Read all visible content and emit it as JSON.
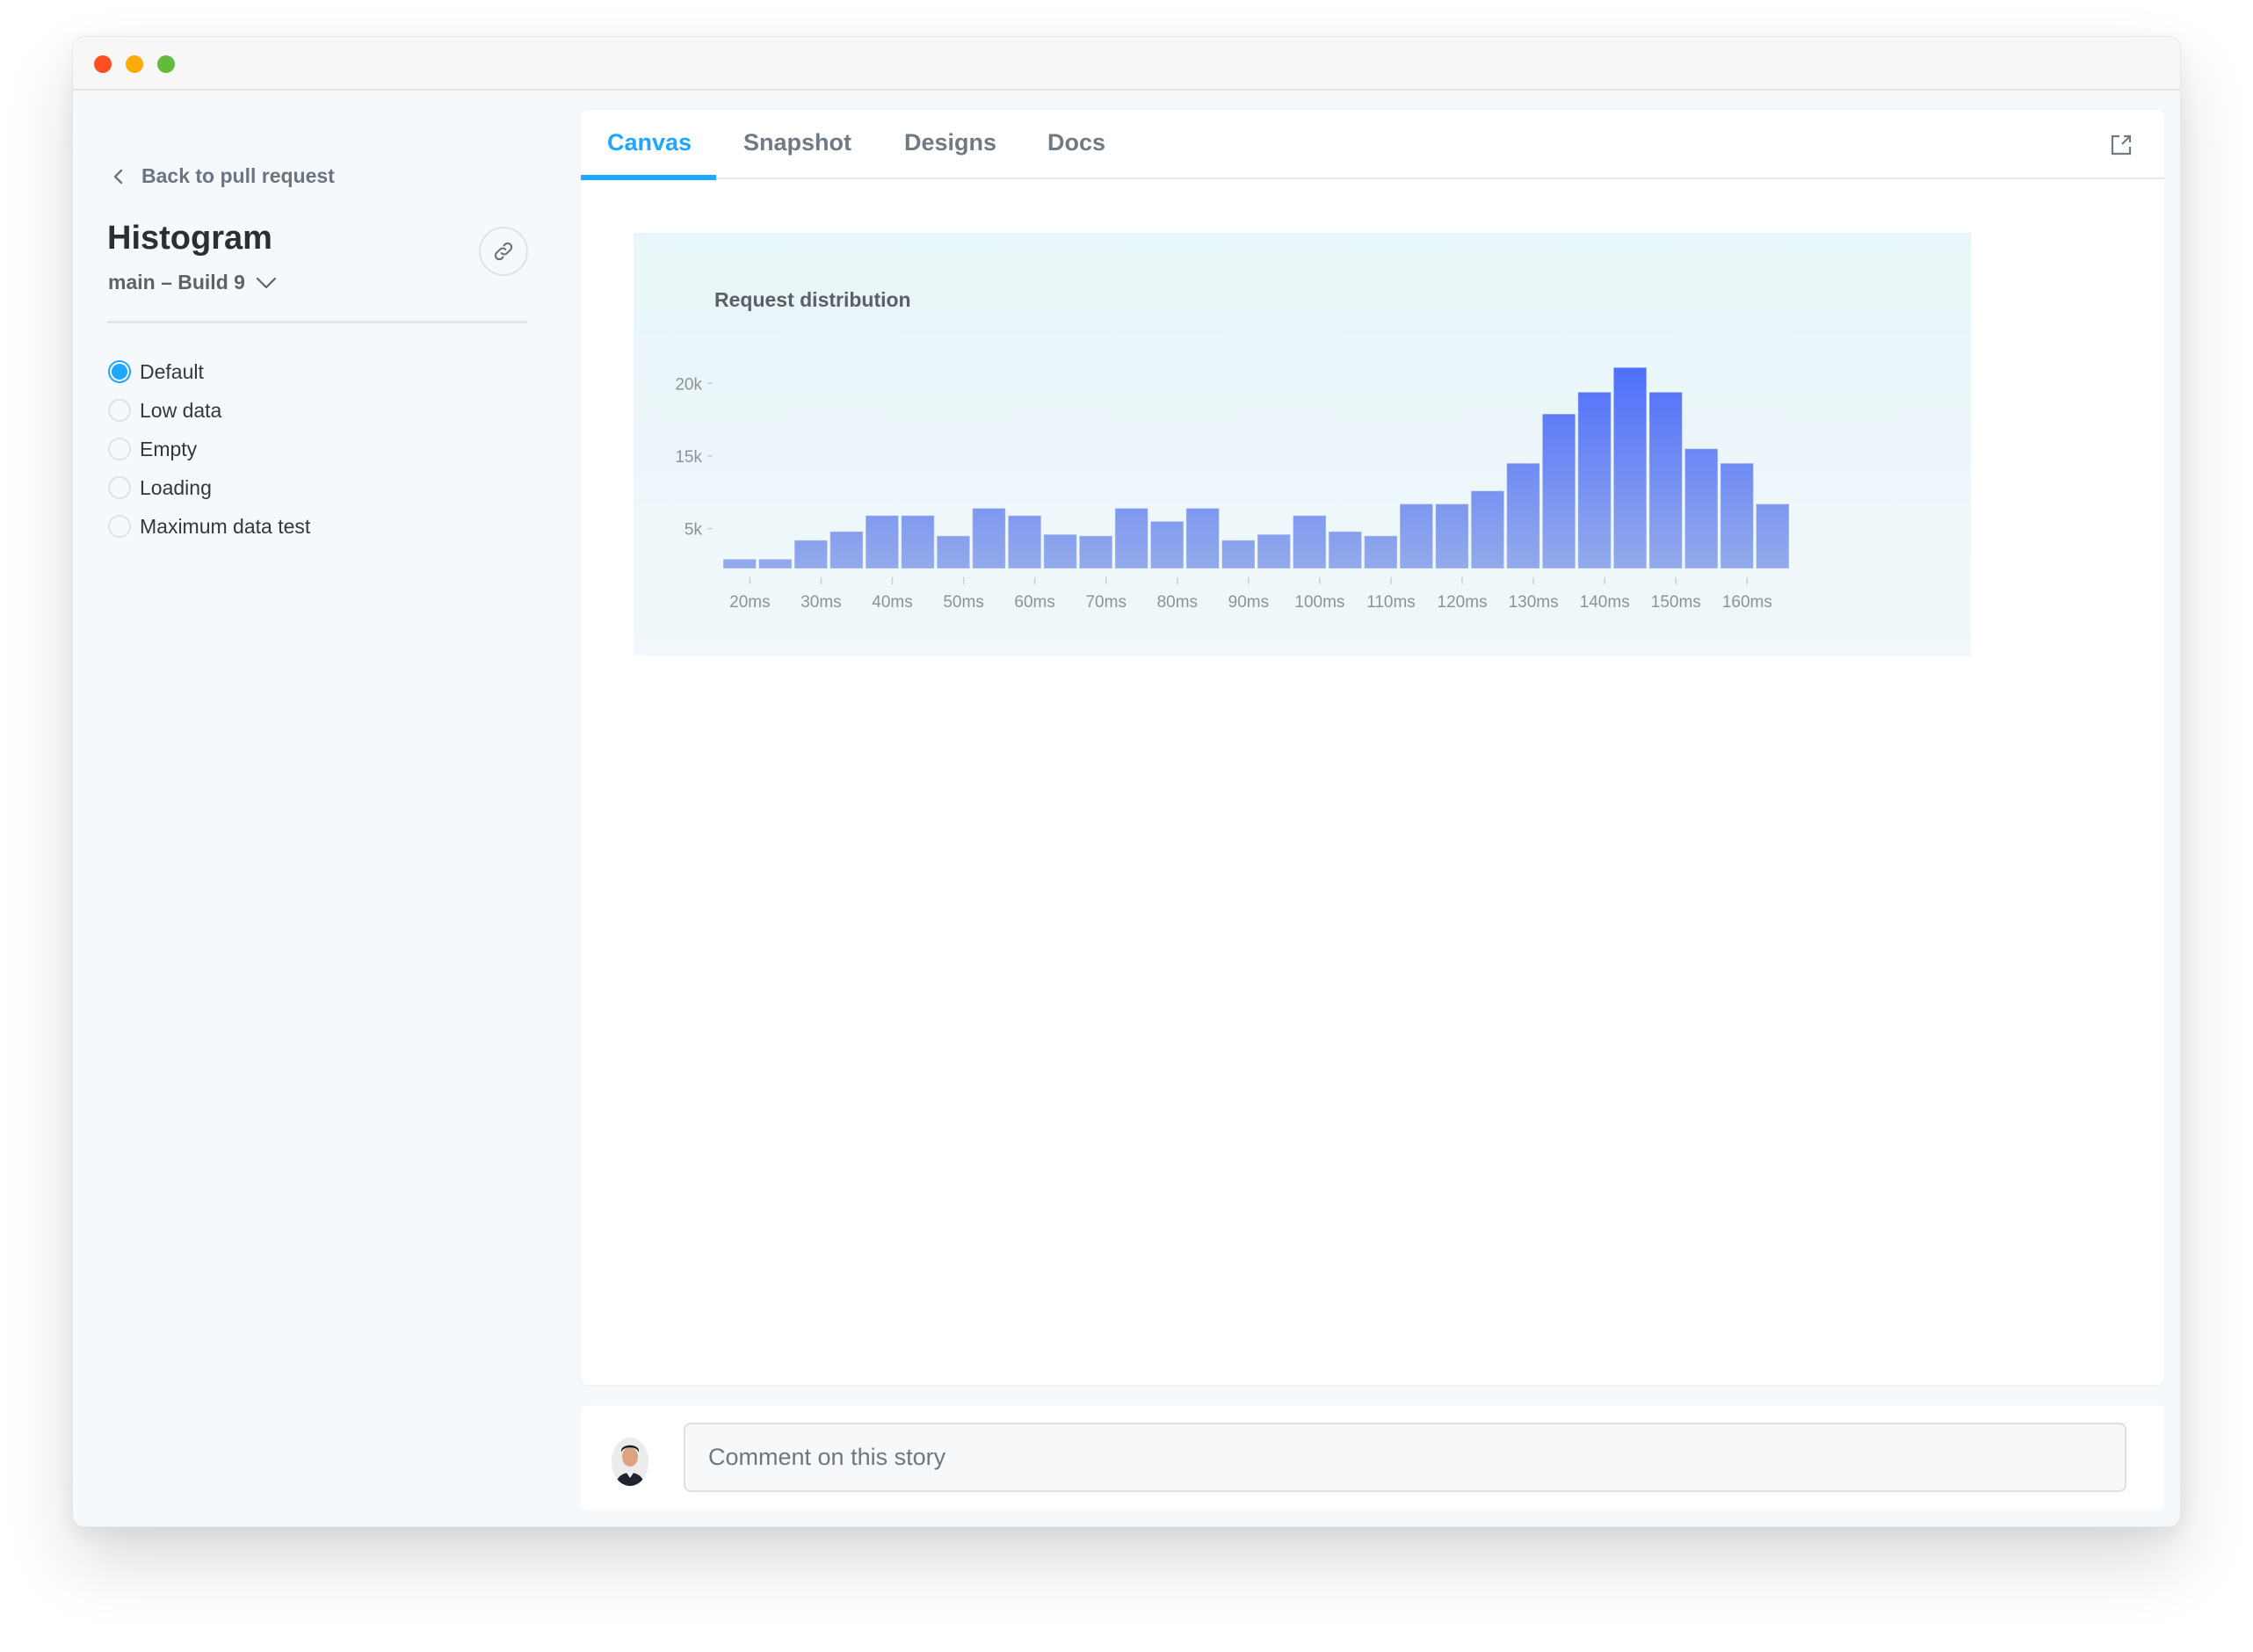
{
  "window": {
    "controls": [
      "close",
      "minimize",
      "zoom"
    ]
  },
  "sidebar": {
    "back_label": "Back to pull request",
    "title": "Histogram",
    "branch_label": "main – Build 9",
    "link_icon": "link-icon",
    "stories": [
      {
        "label": "Default",
        "selected": true
      },
      {
        "label": "Low data",
        "selected": false
      },
      {
        "label": "Empty",
        "selected": false
      },
      {
        "label": "Loading",
        "selected": false
      },
      {
        "label": "Maximum data test",
        "selected": false
      }
    ]
  },
  "tabs": [
    {
      "label": "Canvas",
      "active": true
    },
    {
      "label": "Snapshot",
      "active": false
    },
    {
      "label": "Designs",
      "active": false
    },
    {
      "label": "Docs",
      "active": false
    }
  ],
  "toolbar": {
    "open_external_icon": "external-link-icon"
  },
  "colors": {
    "accent": "#1ea7fd",
    "bar_top": "#4b6bfb",
    "bar_bottom": "#93aaeb"
  },
  "chart_data": {
    "type": "bar",
    "title": "Request distribution",
    "xlabel": "",
    "ylabel": "",
    "x_tick_labels": [
      "20ms",
      "30ms",
      "40ms",
      "50ms",
      "60ms",
      "70ms",
      "80ms",
      "90ms",
      "100ms",
      "110ms",
      "120ms",
      "130ms",
      "140ms",
      "150ms",
      "160ms"
    ],
    "y_ticks": [
      {
        "value": 20000,
        "label": "20k"
      },
      {
        "value": 15000,
        "label": "15k"
      },
      {
        "value": 10000,
        "label": "5k"
      }
    ],
    "ylim": [
      7250,
      21900
    ],
    "bin_width_ms": 5,
    "bins_start_ms": 17.5,
    "values": [
      7900,
      7900,
      9200,
      9800,
      10900,
      10900,
      9500,
      11400,
      10900,
      9600,
      9500,
      11400,
      10500,
      11400,
      9200,
      9600,
      10900,
      9800,
      9500,
      11700,
      11700,
      12600,
      14500,
      17900,
      19400,
      21100,
      19400,
      15500,
      14500,
      11700
    ],
    "grid": false,
    "legend": "none"
  },
  "comment": {
    "placeholder": "Comment on this story",
    "value": ""
  }
}
